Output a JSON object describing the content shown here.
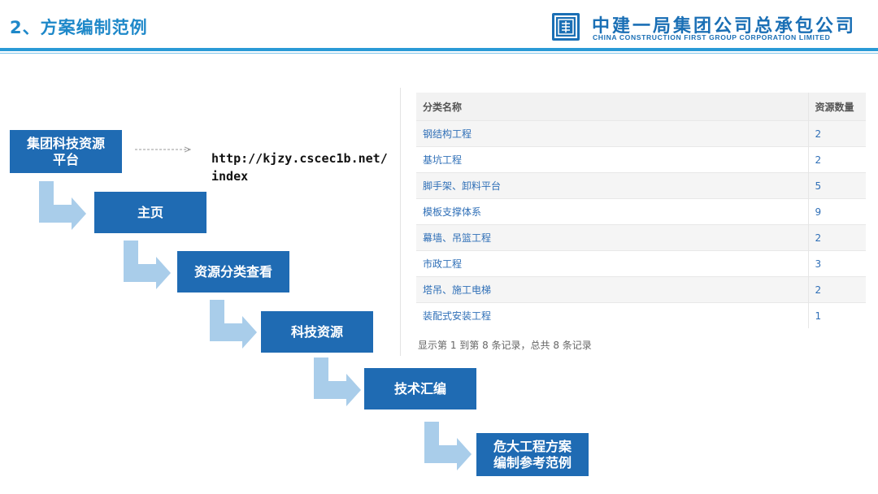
{
  "header": {
    "title": "2、方案编制范例",
    "company_cn": "中建一局集团公司总承包公司",
    "company_en": "CHINA CONSTRUCTION FIRST GROUP CORPORATION LIMITED",
    "logo_icon": "cscec-logo-icon",
    "accent_color": "#1e88c9"
  },
  "flow": {
    "steps": [
      {
        "line1": "集团科技资源",
        "line2": "平台"
      },
      {
        "line1": "主页",
        "line2": ""
      },
      {
        "line1": "资源分类查看",
        "line2": ""
      },
      {
        "line1": "科技资源",
        "line2": ""
      },
      {
        "line1": "技术汇编",
        "line2": ""
      },
      {
        "line1": "危大工程方案",
        "line2": "编制参考范例"
      }
    ],
    "url": "http://kjzy.cscec1b.net/index",
    "step_color": "#1f6bb3",
    "arrow_color": "#a9cdea"
  },
  "table": {
    "headers": [
      "分类名称",
      "资源数量"
    ],
    "rows": [
      {
        "name": "钢结构工程",
        "count": "2"
      },
      {
        "name": "基坑工程",
        "count": "2"
      },
      {
        "name": "脚手架、卸料平台",
        "count": "5"
      },
      {
        "name": "模板支撑体系",
        "count": "9"
      },
      {
        "name": "幕墙、吊篮工程",
        "count": "2"
      },
      {
        "name": "市政工程",
        "count": "3"
      },
      {
        "name": "塔吊、施工电梯",
        "count": "2"
      },
      {
        "name": "装配式安装工程",
        "count": "1"
      }
    ],
    "footer": "显示第 1 到第 8 条记录，总共 8 条记录"
  }
}
